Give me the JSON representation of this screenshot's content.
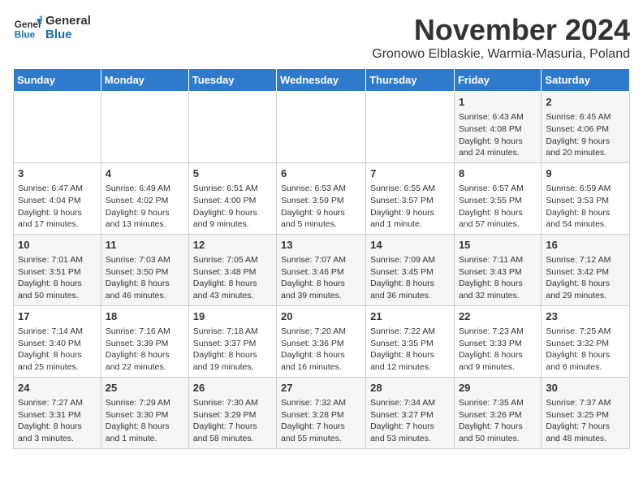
{
  "header": {
    "logo_line1": "General",
    "logo_line2": "Blue",
    "month_title": "November 2024",
    "subtitle": "Gronowo Elblaskie, Warmia-Masuria, Poland"
  },
  "columns": [
    "Sunday",
    "Monday",
    "Tuesday",
    "Wednesday",
    "Thursday",
    "Friday",
    "Saturday"
  ],
  "weeks": [
    [
      {
        "day": "",
        "info": ""
      },
      {
        "day": "",
        "info": ""
      },
      {
        "day": "",
        "info": ""
      },
      {
        "day": "",
        "info": ""
      },
      {
        "day": "",
        "info": ""
      },
      {
        "day": "1",
        "info": "Sunrise: 6:43 AM\nSunset: 4:08 PM\nDaylight: 9 hours and 24 minutes."
      },
      {
        "day": "2",
        "info": "Sunrise: 6:45 AM\nSunset: 4:06 PM\nDaylight: 9 hours and 20 minutes."
      }
    ],
    [
      {
        "day": "3",
        "info": "Sunrise: 6:47 AM\nSunset: 4:04 PM\nDaylight: 9 hours and 17 minutes."
      },
      {
        "day": "4",
        "info": "Sunrise: 6:49 AM\nSunset: 4:02 PM\nDaylight: 9 hours and 13 minutes."
      },
      {
        "day": "5",
        "info": "Sunrise: 6:51 AM\nSunset: 4:00 PM\nDaylight: 9 hours and 9 minutes."
      },
      {
        "day": "6",
        "info": "Sunrise: 6:53 AM\nSunset: 3:59 PM\nDaylight: 9 hours and 5 minutes."
      },
      {
        "day": "7",
        "info": "Sunrise: 6:55 AM\nSunset: 3:57 PM\nDaylight: 9 hours and 1 minute."
      },
      {
        "day": "8",
        "info": "Sunrise: 6:57 AM\nSunset: 3:55 PM\nDaylight: 8 hours and 57 minutes."
      },
      {
        "day": "9",
        "info": "Sunrise: 6:59 AM\nSunset: 3:53 PM\nDaylight: 8 hours and 54 minutes."
      }
    ],
    [
      {
        "day": "10",
        "info": "Sunrise: 7:01 AM\nSunset: 3:51 PM\nDaylight: 8 hours and 50 minutes."
      },
      {
        "day": "11",
        "info": "Sunrise: 7:03 AM\nSunset: 3:50 PM\nDaylight: 8 hours and 46 minutes."
      },
      {
        "day": "12",
        "info": "Sunrise: 7:05 AM\nSunset: 3:48 PM\nDaylight: 8 hours and 43 minutes."
      },
      {
        "day": "13",
        "info": "Sunrise: 7:07 AM\nSunset: 3:46 PM\nDaylight: 8 hours and 39 minutes."
      },
      {
        "day": "14",
        "info": "Sunrise: 7:09 AM\nSunset: 3:45 PM\nDaylight: 8 hours and 36 minutes."
      },
      {
        "day": "15",
        "info": "Sunrise: 7:11 AM\nSunset: 3:43 PM\nDaylight: 8 hours and 32 minutes."
      },
      {
        "day": "16",
        "info": "Sunrise: 7:12 AM\nSunset: 3:42 PM\nDaylight: 8 hours and 29 minutes."
      }
    ],
    [
      {
        "day": "17",
        "info": "Sunrise: 7:14 AM\nSunset: 3:40 PM\nDaylight: 8 hours and 25 minutes."
      },
      {
        "day": "18",
        "info": "Sunrise: 7:16 AM\nSunset: 3:39 PM\nDaylight: 8 hours and 22 minutes."
      },
      {
        "day": "19",
        "info": "Sunrise: 7:18 AM\nSunset: 3:37 PM\nDaylight: 8 hours and 19 minutes."
      },
      {
        "day": "20",
        "info": "Sunrise: 7:20 AM\nSunset: 3:36 PM\nDaylight: 8 hours and 16 minutes."
      },
      {
        "day": "21",
        "info": "Sunrise: 7:22 AM\nSunset: 3:35 PM\nDaylight: 8 hours and 12 minutes."
      },
      {
        "day": "22",
        "info": "Sunrise: 7:23 AM\nSunset: 3:33 PM\nDaylight: 8 hours and 9 minutes."
      },
      {
        "day": "23",
        "info": "Sunrise: 7:25 AM\nSunset: 3:32 PM\nDaylight: 8 hours and 6 minutes."
      }
    ],
    [
      {
        "day": "24",
        "info": "Sunrise: 7:27 AM\nSunset: 3:31 PM\nDaylight: 8 hours and 3 minutes."
      },
      {
        "day": "25",
        "info": "Sunrise: 7:29 AM\nSunset: 3:30 PM\nDaylight: 8 hours and 1 minute."
      },
      {
        "day": "26",
        "info": "Sunrise: 7:30 AM\nSunset: 3:29 PM\nDaylight: 7 hours and 58 minutes."
      },
      {
        "day": "27",
        "info": "Sunrise: 7:32 AM\nSunset: 3:28 PM\nDaylight: 7 hours and 55 minutes."
      },
      {
        "day": "28",
        "info": "Sunrise: 7:34 AM\nSunset: 3:27 PM\nDaylight: 7 hours and 53 minutes."
      },
      {
        "day": "29",
        "info": "Sunrise: 7:35 AM\nSunset: 3:26 PM\nDaylight: 7 hours and 50 minutes."
      },
      {
        "day": "30",
        "info": "Sunrise: 7:37 AM\nSunset: 3:25 PM\nDaylight: 7 hours and 48 minutes."
      }
    ]
  ]
}
